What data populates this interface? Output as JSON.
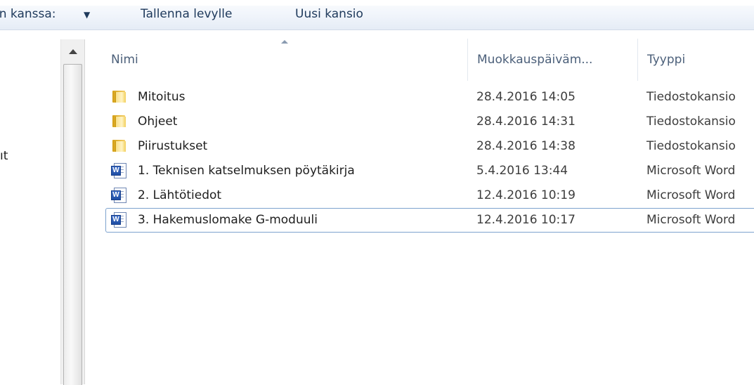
{
  "toolbar": {
    "share_label": "ın kanssa:",
    "share_arrow": "▼",
    "burn_label": "Tallenna levylle",
    "new_folder_label": "Uusi kansio"
  },
  "nav": {
    "cut_text": "ıt"
  },
  "columns": {
    "name": "Nimi",
    "date": "Muokkauspäiväm...",
    "type": "Tyyppi"
  },
  "files": [
    {
      "name": "Mitoitus",
      "date": "28.4.2016 14:05",
      "type": "Tiedostokansio",
      "icon": "folder-icon"
    },
    {
      "name": "Ohjeet",
      "date": "28.4.2016 14:31",
      "type": "Tiedostokansio",
      "icon": "folder-icon"
    },
    {
      "name": "Piirustukset",
      "date": "28.4.2016 14:38",
      "type": "Tiedostokansio",
      "icon": "folder-icon"
    },
    {
      "name": "1. Teknisen katselmuksen pöytäkirja",
      "date": "5.4.2016 13:44",
      "type": "Microsoft Word",
      "icon": "word-document-icon"
    },
    {
      "name": "2. Lähtötiedot",
      "date": "12.4.2016 10:19",
      "type": "Microsoft Word",
      "icon": "word-document-icon"
    },
    {
      "name": "3. Hakemuslomake G-moduuli",
      "date": "12.4.2016 10:17",
      "type": "Microsoft Word",
      "icon": "word-document-icon"
    }
  ]
}
